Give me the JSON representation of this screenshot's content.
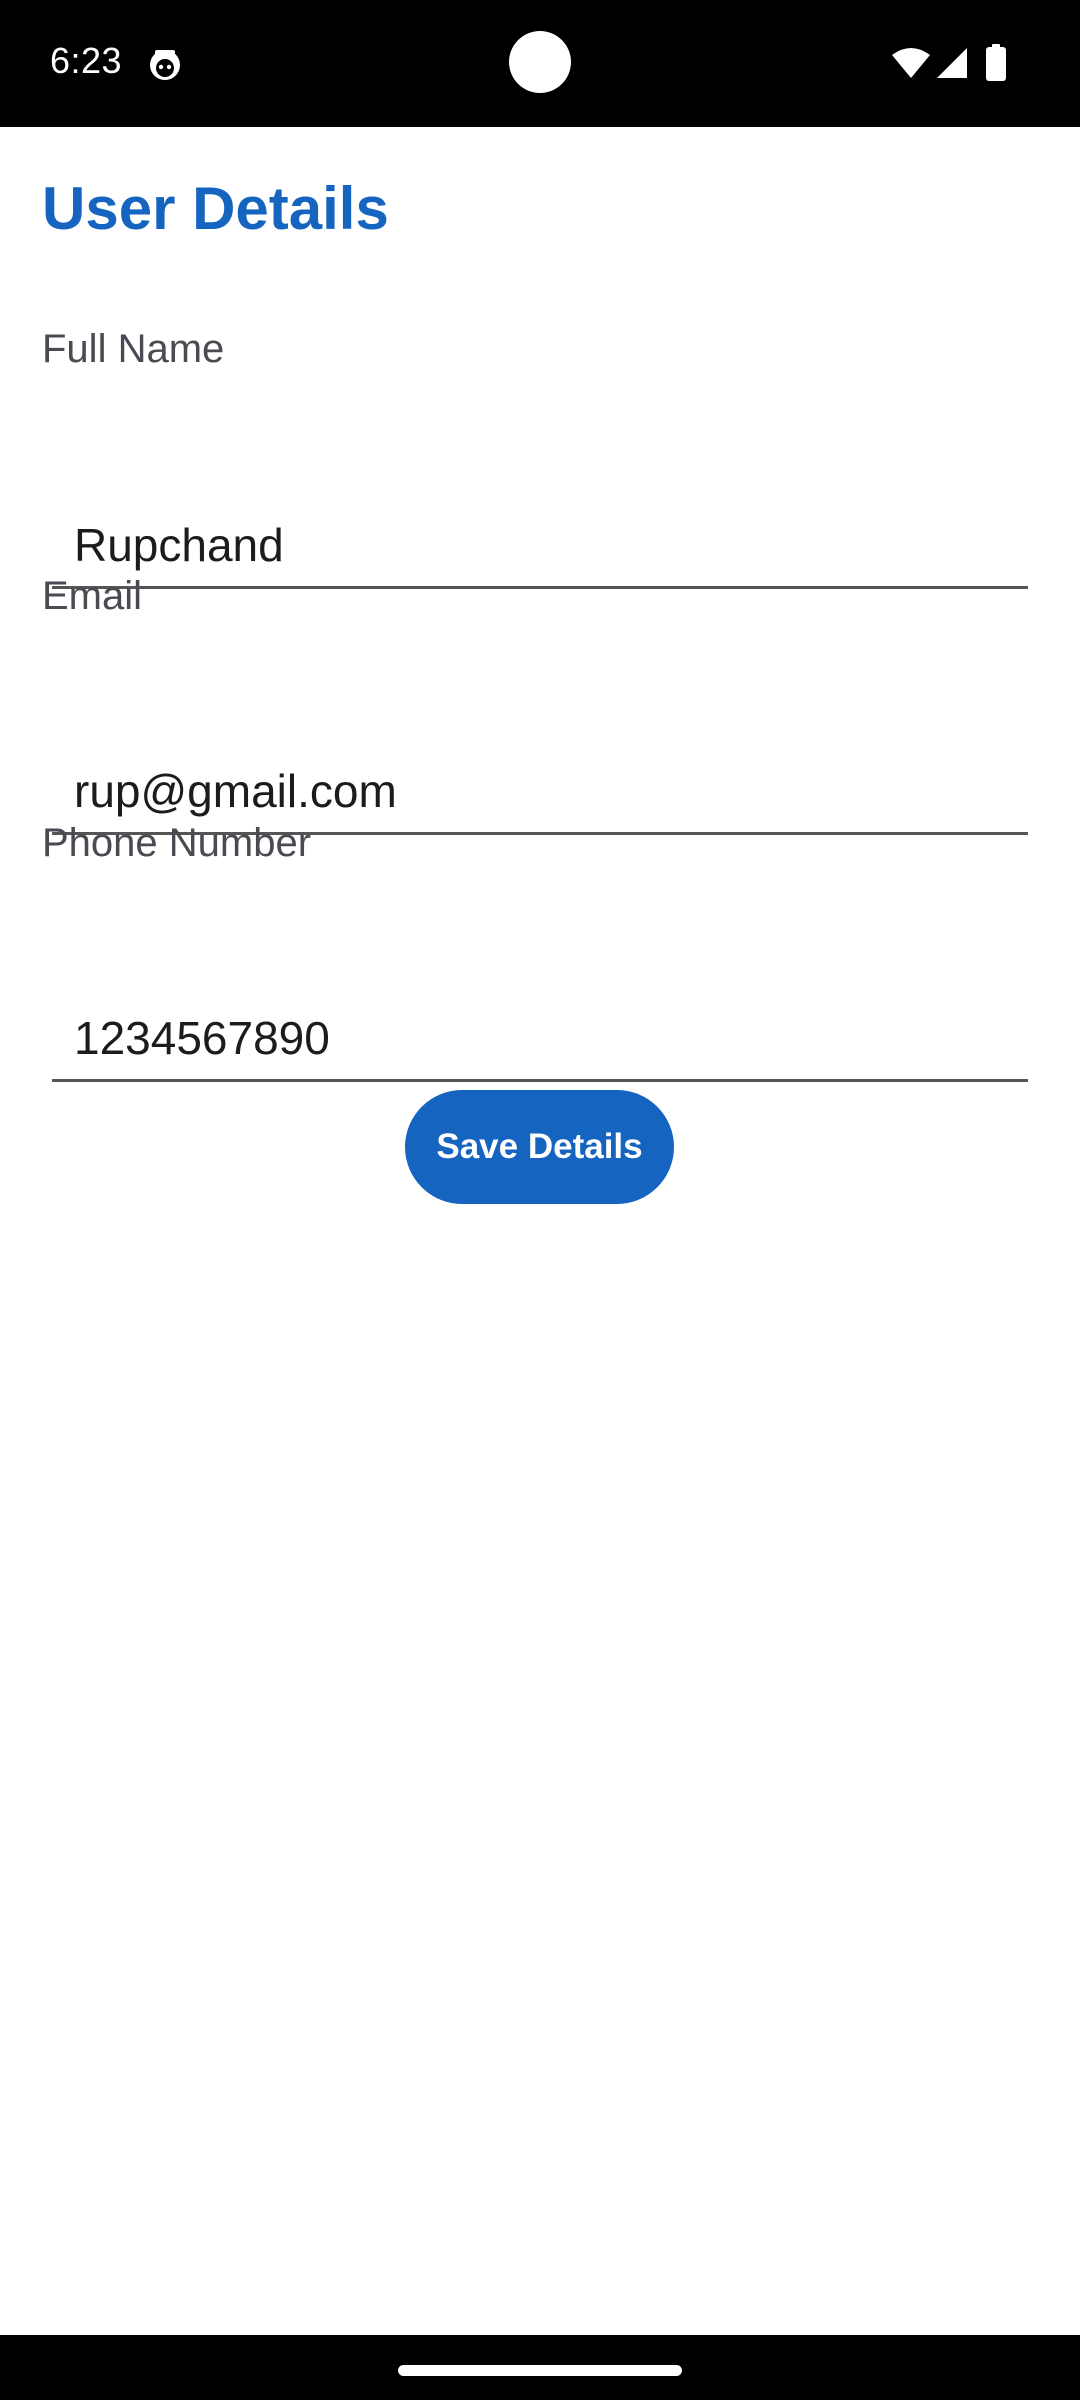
{
  "status_bar": {
    "time": "6:23",
    "icons": [
      "app-notification-icon",
      "wifi-icon",
      "cell-signal-icon",
      "battery-icon"
    ]
  },
  "page": {
    "title": "User Details"
  },
  "form": {
    "full_name": {
      "label": "Full Name",
      "value": "Rupchand"
    },
    "email": {
      "label": "Email",
      "value": "rup@gmail.com"
    },
    "phone": {
      "label": "Phone Number",
      "value": "1234567890"
    },
    "save_label": "Save Details"
  },
  "colors": {
    "accent": "#1565c0",
    "label": "#4a4a52",
    "underline": "#555555",
    "background": "#ffffff",
    "system_bars": "#000000"
  }
}
